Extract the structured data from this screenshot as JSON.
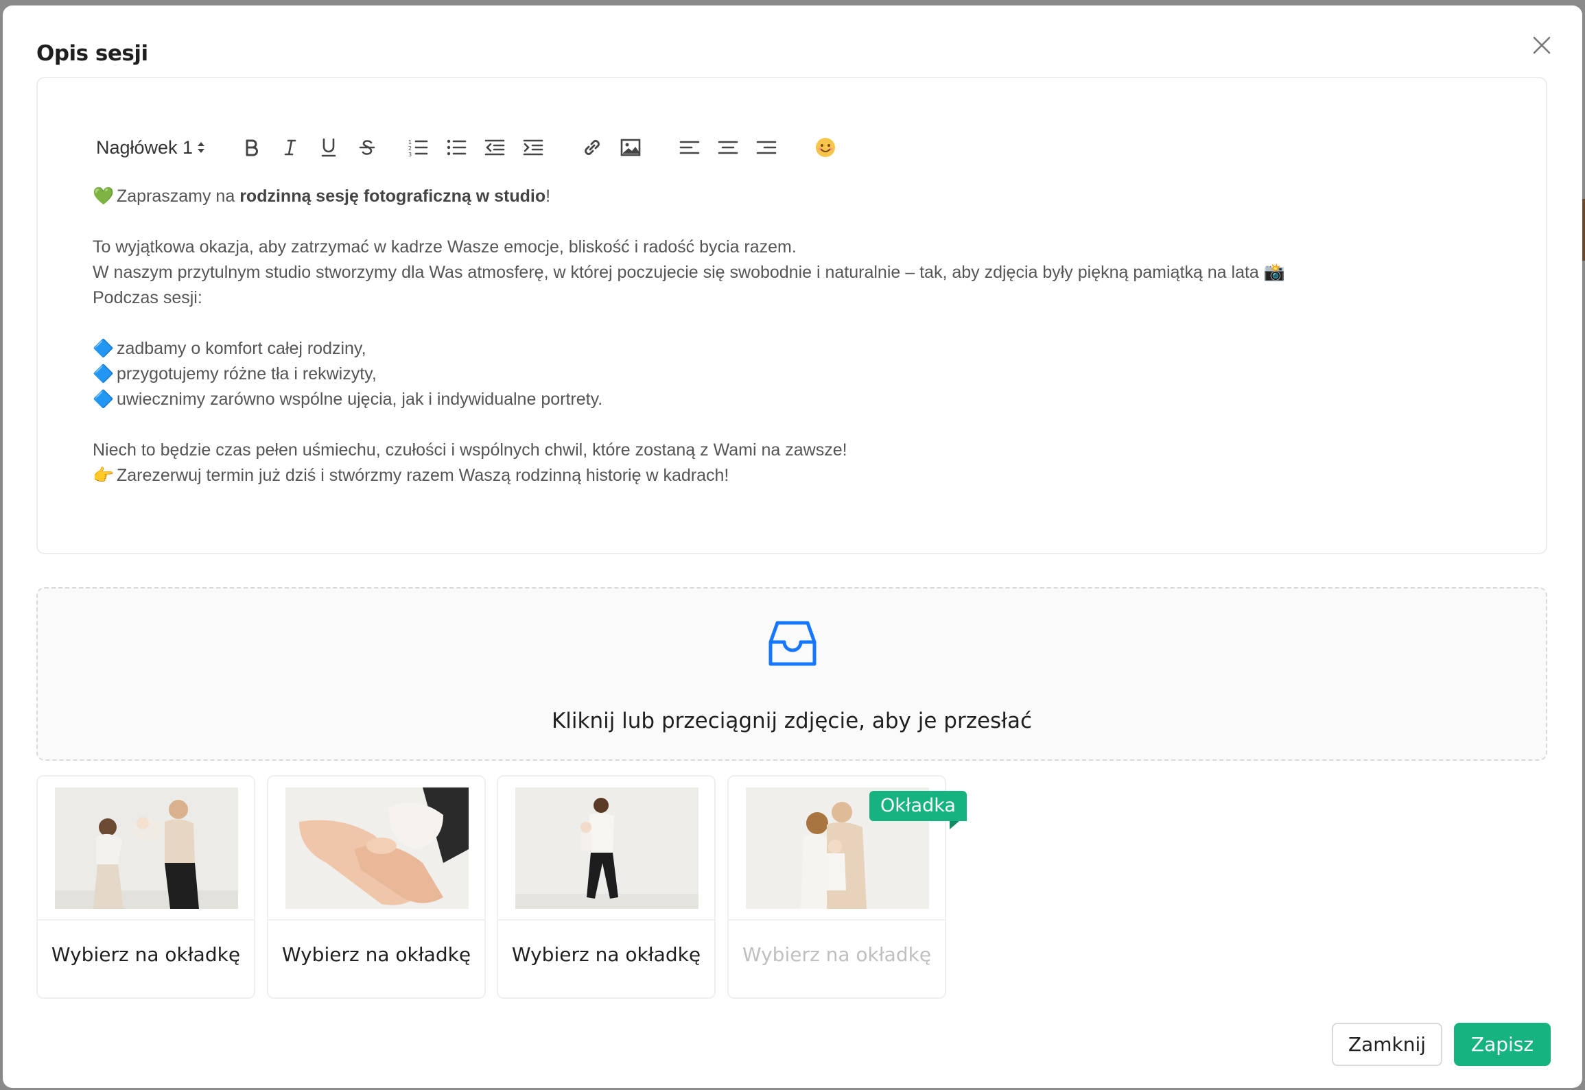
{
  "modal": {
    "title": "Opis sesji"
  },
  "toolbar": {
    "heading_select": "Nagłówek 1",
    "buttons": [
      "bold-icon",
      "italic-icon",
      "underline-icon",
      "strikethrough-icon",
      "ordered-list-icon",
      "bullet-list-icon",
      "outdent-icon",
      "indent-icon",
      "link-icon",
      "image-icon",
      "align-left-icon",
      "align-center-icon",
      "align-right-icon",
      "emoji-icon"
    ]
  },
  "editor": {
    "line1": {
      "emoji": "💚",
      "pre": "Zapraszamy na ",
      "bold": "rodzinną sesję fotograficzną w studio",
      "post": "!"
    },
    "line2": "To wyjątkowa okazja, aby zatrzymać w kadrze Wasze emocje, bliskość i radość bycia razem.",
    "line3": {
      "text": "W naszym przytulnym studio stworzymy dla Was atmosferę, w której poczujecie się swobodnie i naturalnie – tak, aby zdjęcia były piękną pamiątką na lata",
      "emoji": "📸"
    },
    "line4": "Podczas sesji:",
    "bullets": [
      {
        "emoji": "🔷",
        "text": "zadbamy o komfort całej rodziny,"
      },
      {
        "emoji": "🔷",
        "text": "przygotujemy różne tła i rekwizyty,"
      },
      {
        "emoji": "🔷",
        "text": "uwiecznimy zarówno wspólne ujęcia, jak i indywidualne portrety."
      }
    ],
    "line5": "Niech to będzie czas pełen uśmiechu, czułości i wspólnych chwil, które zostaną z Wami na zawsze!",
    "line6": {
      "emoji": "👉",
      "text": "Zarezerwuj termin już dziś i stwórzmy razem Waszą rodzinną historię w kadrach!"
    }
  },
  "upload": {
    "text": "Kliknij lub przeciągnij zdjęcie, aby je przesłać",
    "icon": "inbox-icon"
  },
  "photos": [
    {
      "pick_label": "Wybierz na okładkę",
      "is_cover": false
    },
    {
      "pick_label": "Wybierz na okładkę",
      "is_cover": false
    },
    {
      "pick_label": "Wybierz na okładkę",
      "is_cover": false
    },
    {
      "pick_label": "Wybierz na okładkę",
      "is_cover": true
    }
  ],
  "cover_badge": "Okładka",
  "footer": {
    "close_label": "Zamknij",
    "save_label": "Zapisz"
  },
  "colors": {
    "accent": "#16b27f",
    "upload_icon": "#1677ff"
  }
}
